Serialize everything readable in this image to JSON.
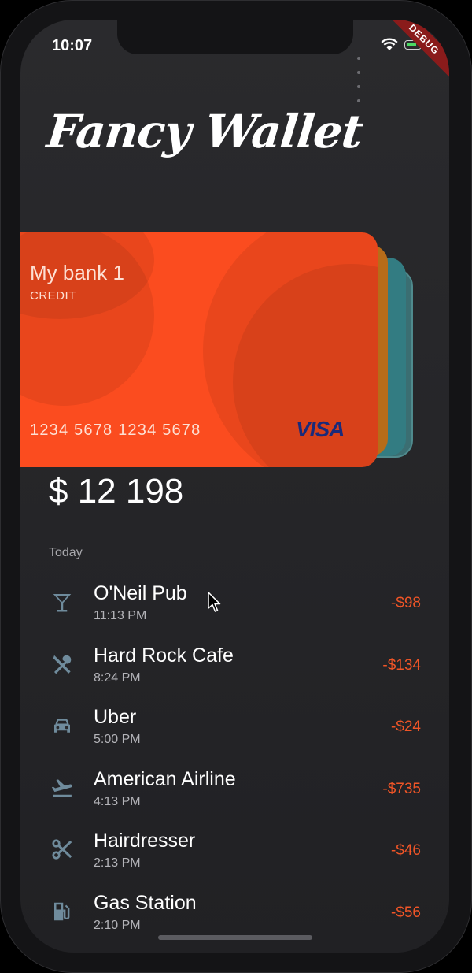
{
  "status_bar": {
    "time": "10:07"
  },
  "debug_banner": "DEBUG",
  "app": {
    "logo": "Fancy Wallet"
  },
  "card": {
    "bank_name": "My bank 1",
    "type": "CREDIT",
    "number": "1234 5678 1234 5678",
    "brand": "VISA",
    "color": "#fb4c1f"
  },
  "balance": "$ 12 198",
  "section_label": "Today",
  "transactions": [
    {
      "name": "O'Neil Pub",
      "time": "11:13 PM",
      "amount": "-$98",
      "icon": "cocktail-icon"
    },
    {
      "name": "Hard Rock Cafe",
      "time": "8:24 PM",
      "amount": "-$134",
      "icon": "restaurant-icon"
    },
    {
      "name": "Uber",
      "time": "5:00 PM",
      "amount": "-$24",
      "icon": "car-icon"
    },
    {
      "name": "American Airline",
      "time": "4:13 PM",
      "amount": "-$735",
      "icon": "flight-takeoff-icon"
    },
    {
      "name": "Hairdresser",
      "time": "2:13 PM",
      "amount": "-$46",
      "icon": "scissors-icon"
    },
    {
      "name": "Gas Station",
      "time": "2:10 PM",
      "amount": "-$56",
      "icon": "gas-station-icon"
    }
  ],
  "colors": {
    "accent": "#f05527",
    "icon": "#6f8b9c",
    "background": "#29292c"
  }
}
